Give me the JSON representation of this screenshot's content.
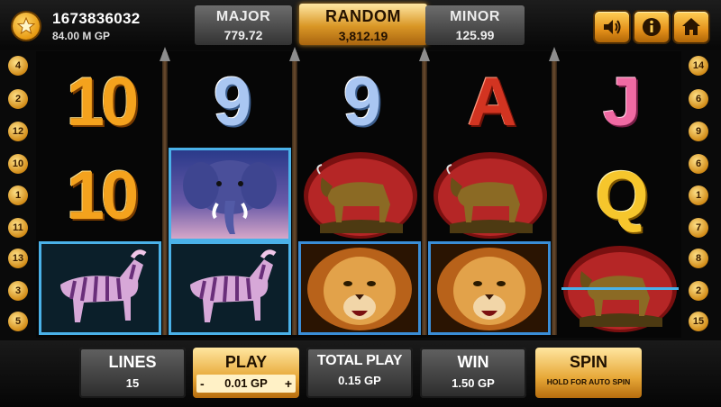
{
  "account": {
    "id": "1673836032",
    "balance": "84.00 M GP"
  },
  "jackpots": {
    "major": {
      "label": "MAJOR",
      "value": "779.72"
    },
    "random": {
      "label": "RANDOM",
      "value": "3,812.19"
    },
    "minor": {
      "label": "MINOR",
      "value": "125.99"
    }
  },
  "lines_left": [
    "4",
    "2",
    "12",
    "10",
    "1",
    "11",
    "13",
    "3",
    "5"
  ],
  "lines_right": [
    "14",
    "6",
    "9",
    "6",
    "1",
    "7",
    "8",
    "2",
    "15"
  ],
  "reels": {
    "row1": [
      "10",
      "9",
      "9",
      "A",
      "J"
    ],
    "row2": [
      "10",
      "elephant",
      "wildebeest",
      "wildebeest",
      "Q"
    ],
    "row3": [
      "zebra",
      "zebra",
      "lion",
      "lion",
      "wildebeest"
    ]
  },
  "controls": {
    "lines": {
      "label": "LINES",
      "value": "15"
    },
    "play": {
      "label": "PLAY",
      "value": "0.01 GP",
      "minus": "-",
      "plus": "+"
    },
    "total_play": {
      "label": "TOTAL PLAY",
      "value": "0.15 GP"
    },
    "win": {
      "label": "WIN",
      "value": "1.50 GP"
    },
    "spin": {
      "label": "SPIN",
      "sub": "HOLD FOR AUTO SPIN"
    }
  }
}
